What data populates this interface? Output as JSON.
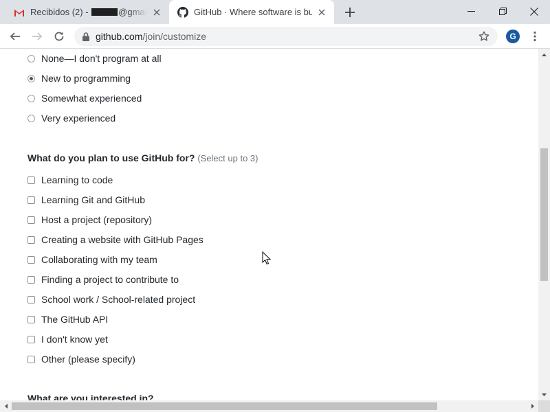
{
  "browser": {
    "tabs": [
      {
        "favicon": "gmail-icon",
        "title_prefix": "Recibidos (2) - ",
        "title_suffix": "@gmail.co",
        "active": false
      },
      {
        "favicon": "github-icon",
        "title": "GitHub · Where software is built",
        "active": true
      }
    ],
    "url_host": "github.com",
    "url_path": "/join/customize",
    "profile_initial": "G",
    "accent_color": "#1a5a9e"
  },
  "experience": {
    "options": [
      {
        "label": "None—I don't program at all",
        "selected": false
      },
      {
        "label": "New to programming",
        "selected": true
      },
      {
        "label": "Somewhat experienced",
        "selected": false
      },
      {
        "label": "Very experienced",
        "selected": false
      }
    ]
  },
  "plan": {
    "heading": "What do you plan to use GitHub for?",
    "hint": "(Select up to 3)",
    "options": [
      {
        "label": "Learning to code",
        "checked": false
      },
      {
        "label": "Learning Git and GitHub",
        "checked": false
      },
      {
        "label": "Host a project (repository)",
        "checked": false
      },
      {
        "label": "Creating a website with GitHub Pages",
        "checked": false
      },
      {
        "label": "Collaborating with my team",
        "checked": false
      },
      {
        "label": "Finding a project to contribute to",
        "checked": false
      },
      {
        "label": "School work / School-related project",
        "checked": false
      },
      {
        "label": "The GitHub API",
        "checked": false
      },
      {
        "label": "I don't know yet",
        "checked": false
      },
      {
        "label": "Other (please specify)",
        "checked": false
      }
    ]
  },
  "next_section": {
    "heading": "What are you interested in?"
  }
}
